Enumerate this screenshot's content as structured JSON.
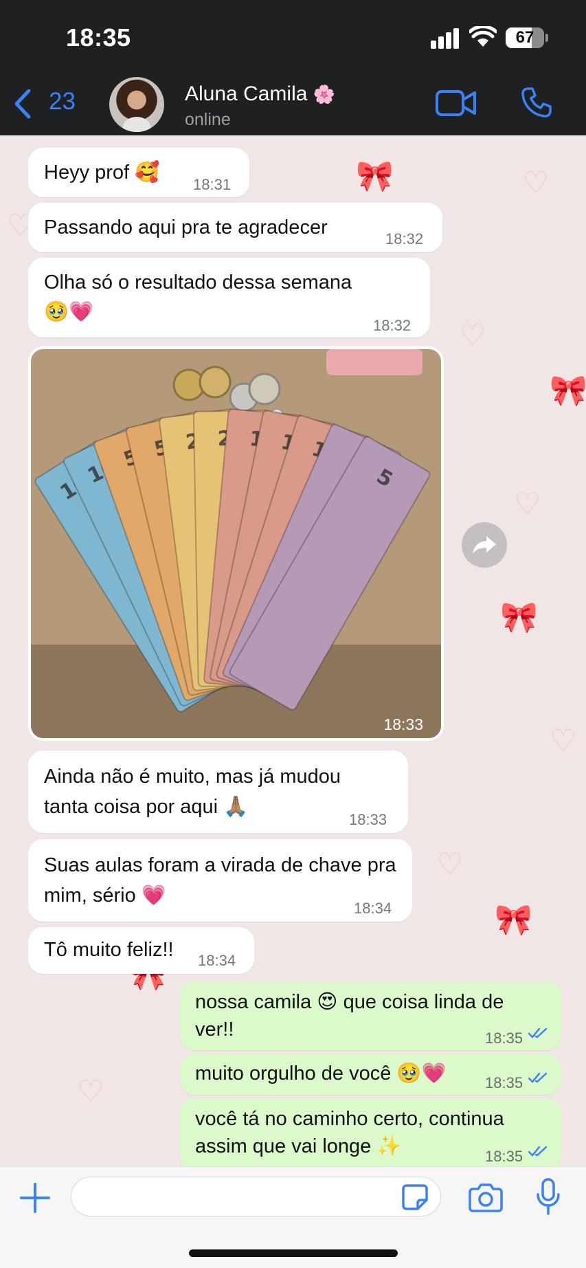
{
  "status_bar": {
    "time": "18:35",
    "battery": "67",
    "battery_level": 0.67
  },
  "header": {
    "back_count": "23",
    "contact_name": "Aluna Camila",
    "name_emoji": "🌸",
    "contact_status": "online"
  },
  "messages": [
    {
      "line1": "Heyy prof 🥰",
      "time": "18:31"
    },
    {
      "line1": "Passando aqui pra te agradecer",
      "time": "18:32"
    },
    {
      "line1": "Olha só o resultado dessa semana",
      "line2": "🥹💗",
      "time": "18:32"
    },
    {
      "time": "18:33"
    },
    {
      "line1": "Ainda não é muito, mas já mudou",
      "line2": "tanta coisa por aqui 🙏🏽",
      "time": "18:33"
    },
    {
      "line1": "Suas aulas foram a virada de chave pra",
      "line2": "mim, sério 💗",
      "time": "18:34"
    },
    {
      "line1": "Tô muito feliz!!",
      "time": "18:34"
    },
    {
      "line1": "nossa camila 😍 que coisa linda de",
      "line2": "ver!!",
      "time": "18:35"
    },
    {
      "line1": "muito orgulho de você 🥹💗",
      "time": "18:35"
    },
    {
      "line1": "você tá no caminho certo, continua",
      "line2": "assim que vai longe ✨",
      "time": "18:35"
    }
  ],
  "banknotes": [
    "100",
    "100",
    "50",
    "50",
    "20",
    "20",
    "10",
    "10",
    "10",
    "5",
    "5"
  ],
  "colors": {
    "header_bg": "#1f2021",
    "accent": "#3b82f6",
    "incoming_bubble": "#ffffff",
    "outgoing_bubble": "#dcf9cb",
    "read_ticks": "#3b82f6"
  }
}
